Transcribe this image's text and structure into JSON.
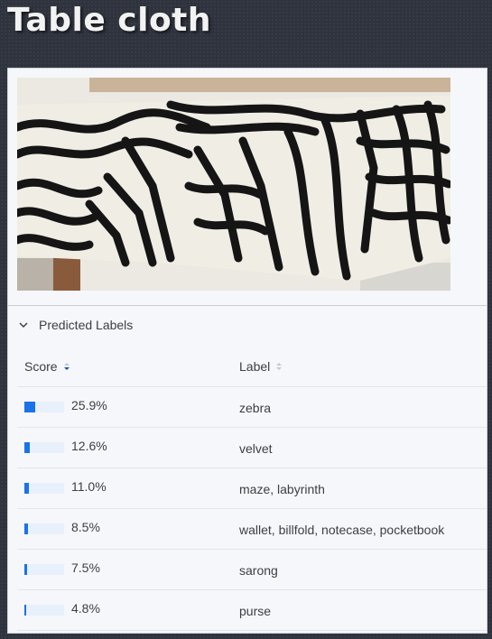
{
  "page": {
    "title": "Table cloth"
  },
  "section": {
    "title": "Predicted Labels"
  },
  "table": {
    "headers": {
      "score": "Score",
      "label": "Label"
    },
    "rows": [
      {
        "score": "25.9%",
        "fraction": 0.259,
        "label": "zebra"
      },
      {
        "score": "12.6%",
        "fraction": 0.126,
        "label": "velvet"
      },
      {
        "score": "11.0%",
        "fraction": 0.11,
        "label": "maze, labyrinth"
      },
      {
        "score": "8.5%",
        "fraction": 0.085,
        "label": "wallet, billfold, notecase, pocketbook"
      },
      {
        "score": "7.5%",
        "fraction": 0.075,
        "label": "sarong"
      },
      {
        "score": "4.8%",
        "fraction": 0.048,
        "label": "purse"
      }
    ]
  },
  "colors": {
    "accent": "#1a73e8",
    "track": "#e8f0fc",
    "text": "#3c4043",
    "background": "#2f333d"
  },
  "icons": {
    "section_toggle": "chevron-down-icon",
    "score_sort": "sort-desc-icon",
    "label_sort": "sort-icon"
  }
}
